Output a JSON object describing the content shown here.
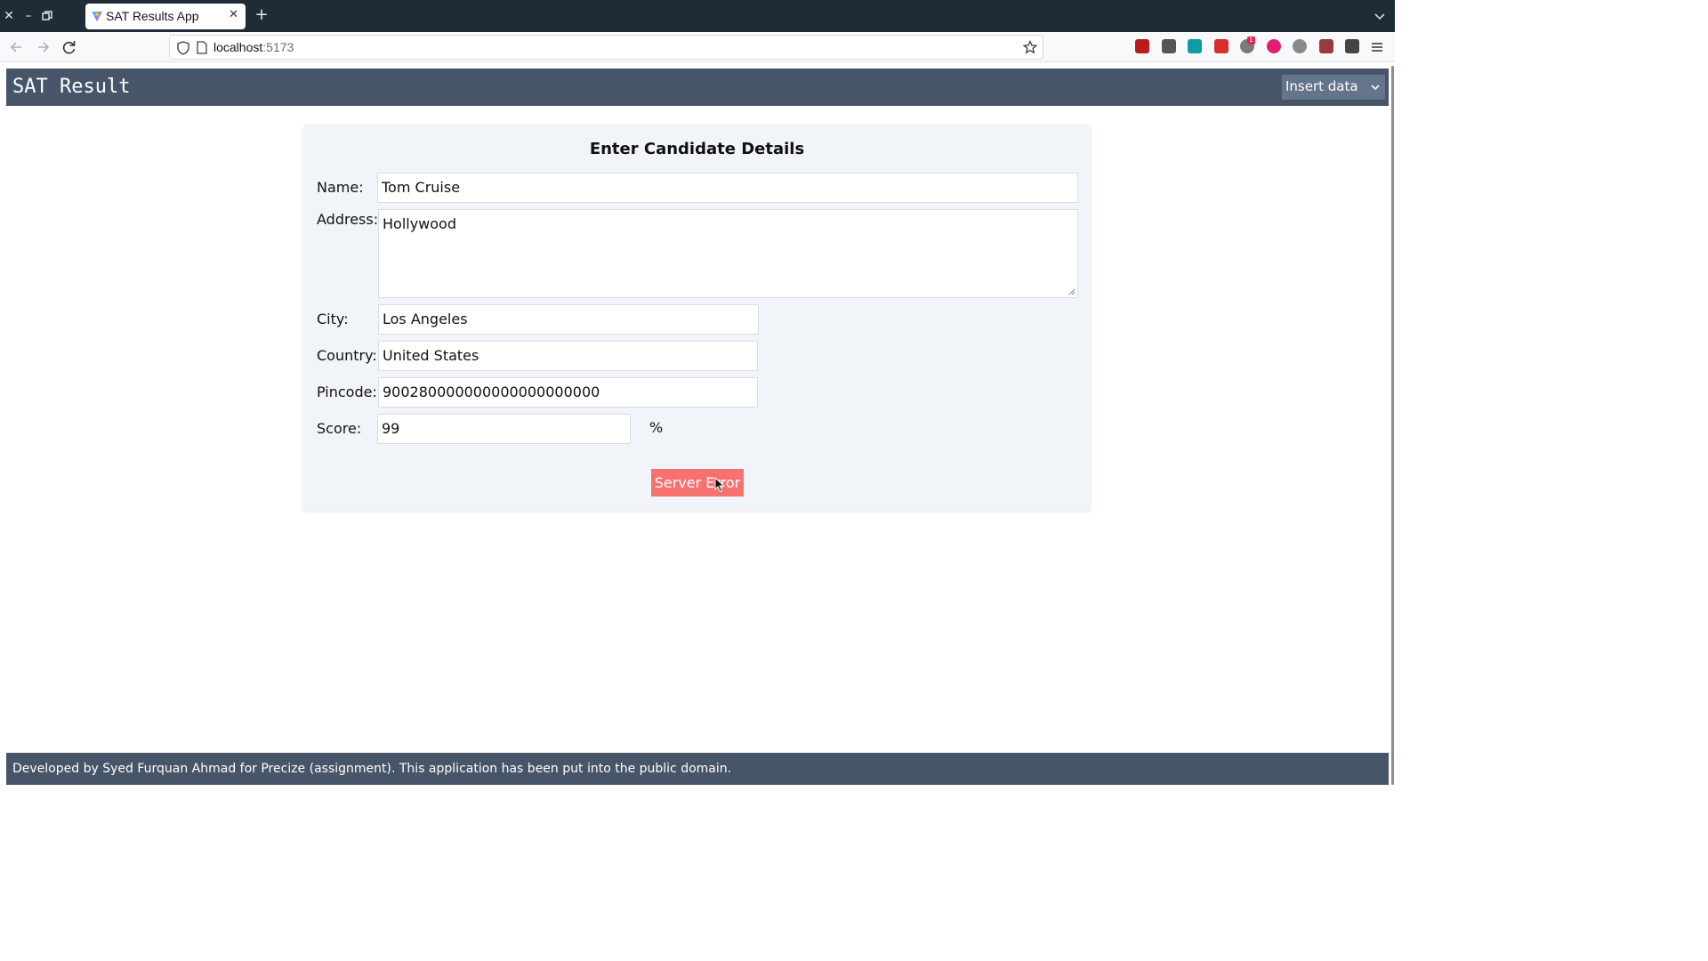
{
  "browser": {
    "tab_title": "SAT Results App",
    "url_host": "localhost",
    "url_port": ":5173",
    "extensions": [
      {
        "name": "ublock-icon",
        "color": "#b91c1c"
      },
      {
        "name": "extension-icon-2",
        "color": "#555555"
      },
      {
        "name": "save-icon",
        "color": "#0e9aa7"
      },
      {
        "name": "extension-icon-4",
        "color": "#d92e2e"
      },
      {
        "name": "extension-icon-5",
        "color": "#7a7a7a"
      },
      {
        "name": "play-icon",
        "color": "#e11d74"
      },
      {
        "name": "globe-icon",
        "color": "#8a8a8a"
      },
      {
        "name": "extension-icon-8",
        "color": "#9b3a3a"
      },
      {
        "name": "extensions-puzzle-icon",
        "color": "#444444"
      }
    ],
    "badge": "1"
  },
  "app": {
    "title": "SAT Result",
    "mode_select": "Insert data"
  },
  "form": {
    "heading": "Enter Candidate Details",
    "name_label": "Name:",
    "name_value": "Tom Cruise",
    "address_label": "Address:",
    "address_value": "Hollywood",
    "city_label": "City:",
    "city_value": "Los Angeles",
    "country_label": "Country:",
    "country_value": "United States",
    "pincode_label": "Pincode:",
    "pincode_value": "900280000000000000000000",
    "score_label": "Score:",
    "score_value": "99",
    "score_unit": "%",
    "submit_label": "Server Error"
  },
  "footer": {
    "text": "Developed by Syed Furquan Ahmad for Precize (assignment). This application has been put into the public domain."
  },
  "colors": {
    "header_bg": "#475569",
    "card_bg": "#f1f5f9",
    "error_button": "#f87171"
  }
}
